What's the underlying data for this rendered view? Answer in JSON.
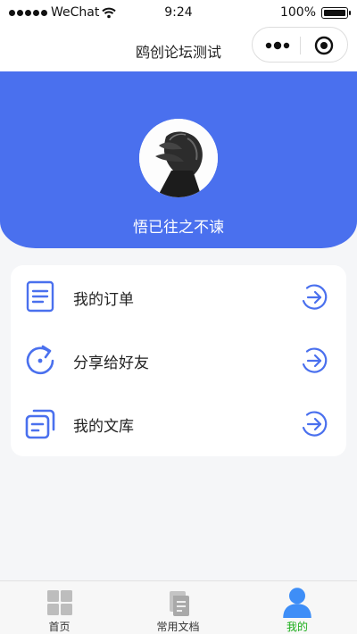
{
  "status_bar": {
    "carrier": "WeChat",
    "time": "9:24",
    "battery": "100%"
  },
  "nav": {
    "title": "鸥创论坛测试"
  },
  "profile": {
    "username": "悟已往之不谏"
  },
  "menu": {
    "items": [
      {
        "label": "我的订单",
        "icon": "order-list-icon"
      },
      {
        "label": "分享给好友",
        "icon": "share-refresh-icon"
      },
      {
        "label": "我的文库",
        "icon": "library-icon"
      }
    ]
  },
  "tabs": [
    {
      "label": "首页",
      "icon": "home-grid-icon",
      "active": false
    },
    {
      "label": "常用文档",
      "icon": "document-icon",
      "active": false
    },
    {
      "label": "我的",
      "icon": "user-icon",
      "active": true
    }
  ],
  "colors": {
    "accent": "#4a70ee",
    "tab_active": "#1aad19",
    "background": "#f5f6f8"
  }
}
